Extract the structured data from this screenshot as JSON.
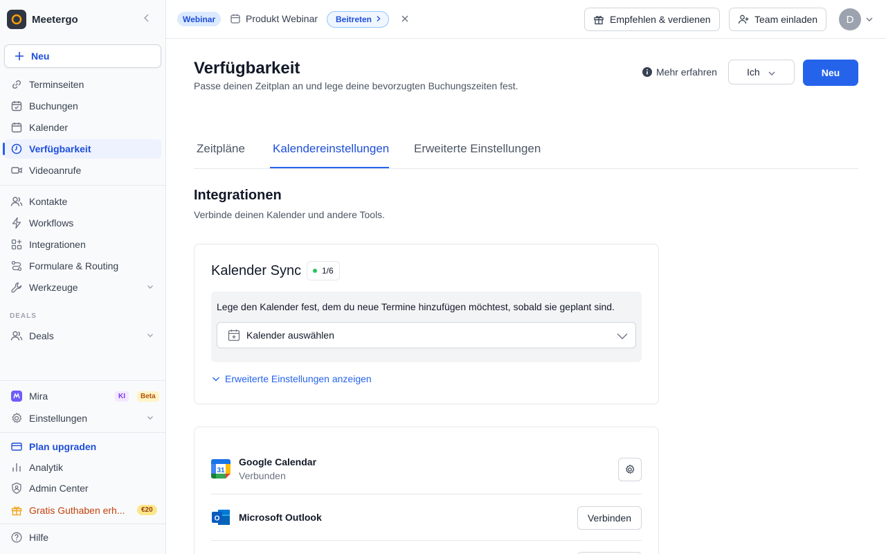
{
  "brand": {
    "name": "Meetergo"
  },
  "sidebar": {
    "new_label": "Neu",
    "items": [
      {
        "label": "Terminseiten",
        "icon": "link-icon"
      },
      {
        "label": "Buchungen",
        "icon": "calendar-check-icon"
      },
      {
        "label": "Kalender",
        "icon": "calendar-icon"
      },
      {
        "label": "Verfügbarkeit",
        "icon": "clock-icon",
        "active": true
      },
      {
        "label": "Videoanrufe",
        "icon": "video-icon"
      },
      {
        "label": "Kontakte",
        "icon": "users-icon"
      },
      {
        "label": "Workflows",
        "icon": "bolt-icon"
      },
      {
        "label": "Integrationen",
        "icon": "grid-plus-icon"
      },
      {
        "label": "Formulare & Routing",
        "icon": "routing-icon"
      },
      {
        "label": "Werkzeuge",
        "icon": "wrench-icon",
        "expandable": true
      }
    ],
    "deals_section_label": "DEALS",
    "deals": {
      "label": "Deals",
      "icon": "users-icon"
    },
    "bottom": {
      "mira": {
        "label": "Mira",
        "ki_badge": "KI",
        "beta_badge": "Beta"
      },
      "settings": {
        "label": "Einstellungen"
      },
      "upgrade": {
        "label": "Plan upgraden"
      },
      "analytics": {
        "label": "Analytik"
      },
      "admin": {
        "label": "Admin Center"
      },
      "credit": {
        "label": "Gratis Guthaben erh...",
        "badge": "€20"
      },
      "help": {
        "label": "Hilfe"
      }
    }
  },
  "topbar": {
    "webinar_badge": "Webinar",
    "webinar_name": "Produkt Webinar",
    "join_label": "Beitreten",
    "refer_label": "Empfehlen & verdienen",
    "invite_label": "Team einladen",
    "avatar_initial": "D"
  },
  "page": {
    "title": "Verfügbarkeit",
    "subtitle": "Passe deinen Zeitplan an und lege deine bevorzugten Buchungszeiten fest.",
    "more_info": "Mehr erfahren",
    "owner_select": "Ich",
    "new_button": "Neu",
    "tabs": [
      "Zeitpläne",
      "Kalendereinstellungen",
      "Erweiterte Einstellungen"
    ],
    "active_tab": 1
  },
  "integrations": {
    "title": "Integrationen",
    "subtitle": "Verbinde deinen Kalender und andere Tools.",
    "sync": {
      "title": "Kalender Sync",
      "count": "1/6",
      "description": "Lege den Kalender fest, dem du neue Termine hinzufügen möchtest, sobald sie geplant sind.",
      "select_placeholder": "Kalender auswählen",
      "advanced_link": "Erweiterte Einstellungen anzeigen"
    },
    "list": [
      {
        "name": "Google Calendar",
        "status": "Verbunden",
        "logo_text": "31"
      },
      {
        "name": "Microsoft Outlook",
        "action": "Verbinden",
        "logo_text": "O"
      }
    ]
  },
  "colors": {
    "accent": "#2563eb",
    "sidebar_bg": "#f9fafb"
  }
}
